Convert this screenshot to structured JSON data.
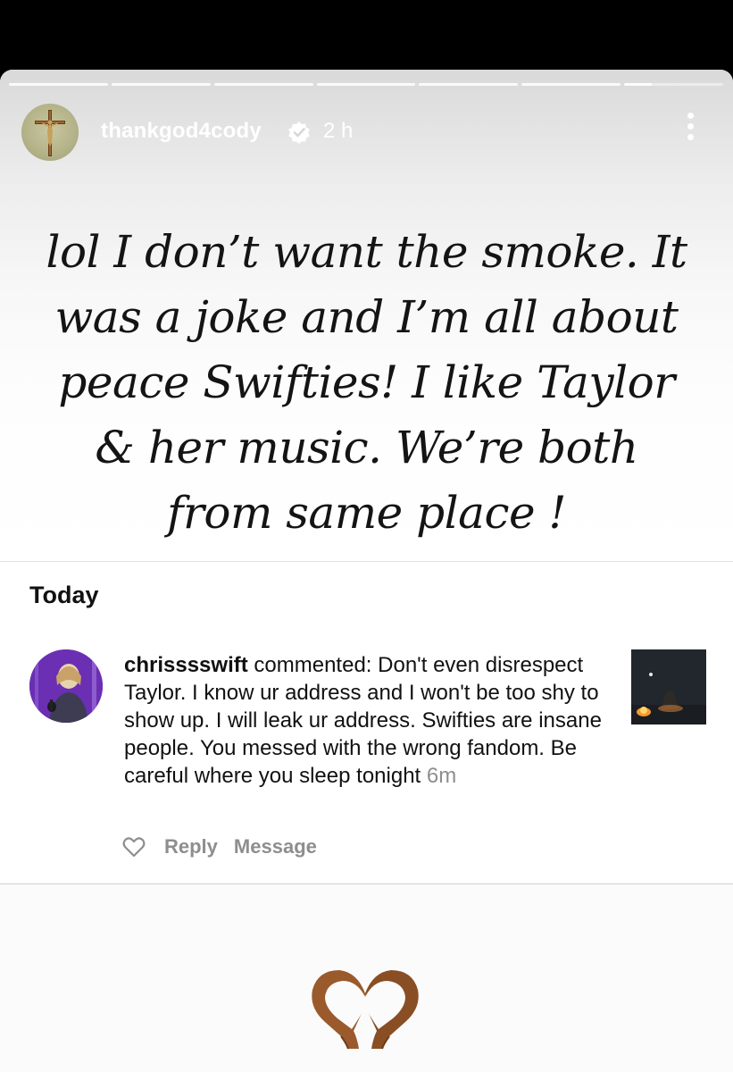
{
  "story": {
    "username": "thankgod4cody",
    "time_ago": "2 h",
    "verified": true,
    "progress_segments": 7,
    "text": "lol I don’t want the smoke. It was a joke and I’m all about peace Swifties! I like Taylor & her music. We’re both from same place !"
  },
  "activity": {
    "section_title": "Today",
    "comment": {
      "username": "chrisssswift",
      "action": "commented:",
      "text": "Don't even disrespect Taylor. I know ur address and I won't be too shy to show up. I will leak ur address. Swifties are insane people. You messed with the wrong fandom. Be careful where you sleep tonight",
      "time_ago": "6m"
    },
    "actions": {
      "reply": "Reply",
      "message": "Message"
    }
  },
  "reaction": {
    "emoji": "heart-hands-icon"
  },
  "icons": {
    "verified": "verified-badge-icon",
    "more": "more-vertical-icon",
    "like": "heart-outline-icon"
  },
  "colors": {
    "verified_blue": "#ffffff",
    "muted_text": "#8e8e8e"
  }
}
